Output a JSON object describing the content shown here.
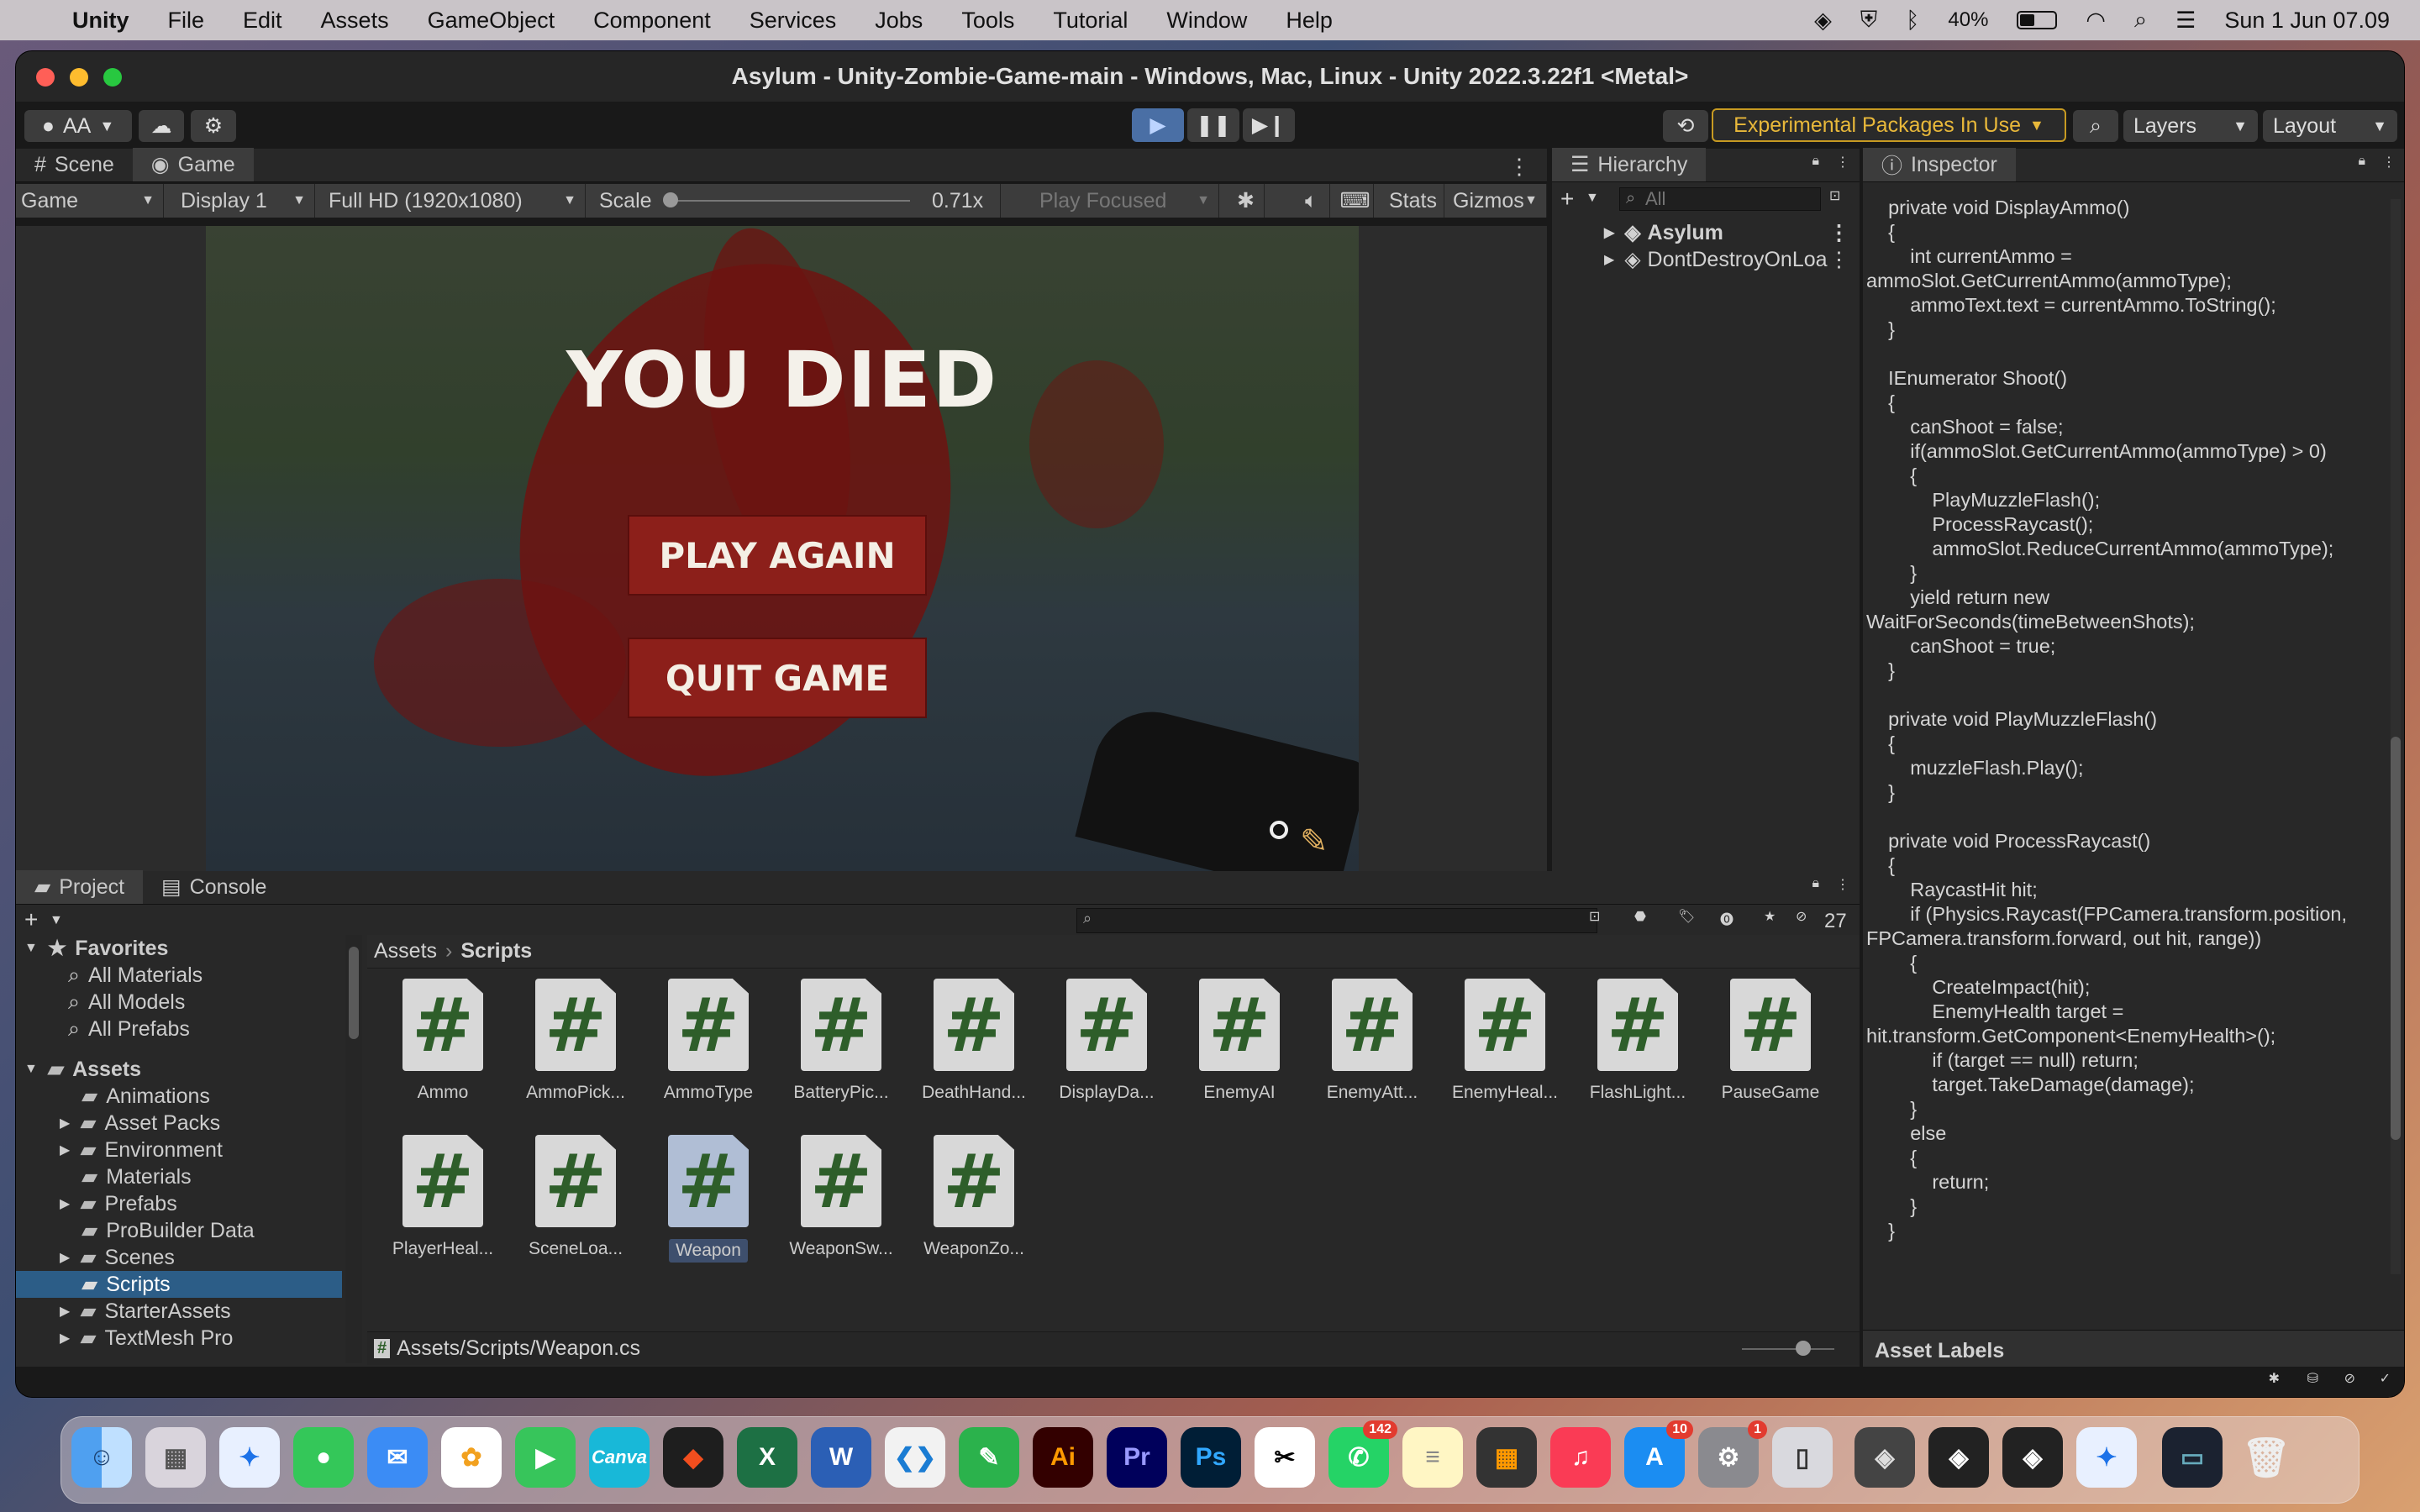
{
  "menubar": {
    "app_name": "Unity",
    "items": [
      "File",
      "Edit",
      "Assets",
      "GameObject",
      "Component",
      "Services",
      "Jobs",
      "Tools",
      "Tutorial",
      "Window",
      "Help"
    ],
    "battery": "40%",
    "datetime": "Sun 1 Jun  07.09"
  },
  "window": {
    "title": "Asylum - Unity-Zombie-Game-main - Windows, Mac, Linux - Unity 2022.3.22f1 <Metal>"
  },
  "toolbar": {
    "account": "AA",
    "experimental": "Experimental Packages In Use",
    "layers": "Layers",
    "layout": "Layout"
  },
  "scene_panel": {
    "tabs": [
      "Scene",
      "Game"
    ],
    "game_mode": "Game",
    "display": "Display 1",
    "resolution": "Full HD (1920x1080)",
    "scale_label": "Scale",
    "scale_value": "0.71x",
    "play_mode": "Play Focused",
    "stats": "Stats",
    "gizmos": "Gizmos"
  },
  "game": {
    "title": "YOU DIED",
    "play_again": "PLAY AGAIN",
    "quit_game": "QUIT GAME"
  },
  "hierarchy": {
    "tab": "Hierarchy",
    "search_placeholder": "All",
    "items": [
      "Asylum",
      "DontDestroyOnLoad"
    ]
  },
  "inspector": {
    "tab": "Inspector",
    "code": "    private void DisplayAmmo()\n    {\n        int currentAmmo =\nammoSlot.GetCurrentAmmo(ammoType);\n        ammoText.text = currentAmmo.ToString();\n    }\n\n    IEnumerator Shoot()\n    {\n        canShoot = false;\n        if(ammoSlot.GetCurrentAmmo(ammoType) > 0)\n        {\n            PlayMuzzleFlash();\n            ProcessRaycast();\n            ammoSlot.ReduceCurrentAmmo(ammoType);\n        }\n        yield return new\nWaitForSeconds(timeBetweenShots);\n        canShoot = true;\n    }\n\n    private void PlayMuzzleFlash()\n    {\n        muzzleFlash.Play();\n    }\n\n    private void ProcessRaycast()\n    {\n        RaycastHit hit;\n        if (Physics.Raycast(FPCamera.transform.position,\nFPCamera.transform.forward, out hit, range))\n        {\n            CreateImpact(hit);\n            EnemyHealth target =\nhit.transform.GetComponent<EnemyHealth>();\n            if (target == null) return;\n            target.TakeDamage(damage);\n        }\n        else\n        {\n            return;\n        }\n    }",
    "asset_labels": "Asset Labels"
  },
  "project_panel": {
    "tabs": [
      "Project",
      "Console"
    ],
    "hidden_count": "27",
    "favorites_label": "Favorites",
    "favorites": [
      "All Materials",
      "All Models",
      "All Prefabs"
    ],
    "assets_label": "Assets",
    "folders": [
      "Animations",
      "Asset Packs",
      "Environment",
      "Materials",
      "Prefabs",
      "ProBuilder Data",
      "Scenes",
      "Scripts",
      "StarterAssets",
      "TextMesh Pro"
    ],
    "breadcrumb_root": "Assets",
    "breadcrumb_current": "Scripts",
    "scripts": [
      "Ammo",
      "AmmoPick...",
      "AmmoType",
      "BatteryPic...",
      "DeathHand...",
      "DisplayDa...",
      "EnemyAI",
      "EnemyAtt...",
      "EnemyHeal...",
      "FlashLight...",
      "PauseGame",
      "PlayerHeal...",
      "SceneLoa...",
      "Weapon",
      "WeaponSw...",
      "WeaponZo..."
    ],
    "selected_path": "Assets/Scripts/Weapon.cs"
  },
  "dock": {
    "badges": {
      "whatsapp": "142",
      "appstore": "10",
      "settings": "1"
    }
  }
}
